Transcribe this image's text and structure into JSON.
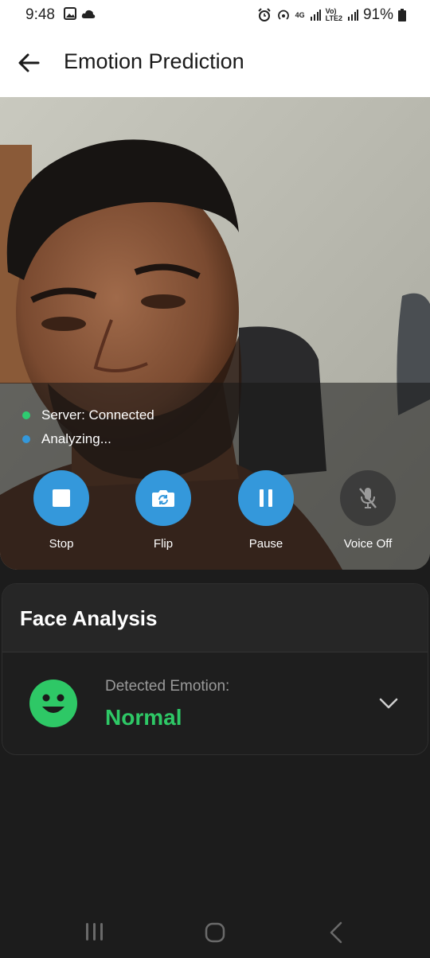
{
  "status_bar": {
    "time": "9:48",
    "network_4g": "4G",
    "volte_top": "Vo)",
    "volte_bottom": "LTE2",
    "battery": "91%"
  },
  "header": {
    "title": "Emotion Prediction",
    "back_icon": "arrow-left-icon"
  },
  "camera": {
    "server_status": "Server: Connected",
    "analysis_status": "Analyzing...",
    "server_dot_color": "#2ecc71",
    "analysis_dot_color": "#3498db",
    "controls": [
      {
        "label": "Stop",
        "icon": "stop-icon",
        "color": "#3498db"
      },
      {
        "label": "Flip",
        "icon": "camera-flip-icon",
        "color": "#3498db"
      },
      {
        "label": "Pause",
        "icon": "pause-icon",
        "color": "#3498db"
      },
      {
        "label": "Voice Off",
        "icon": "mic-off-icon",
        "color": "#2a2a2a"
      }
    ]
  },
  "face_analysis": {
    "title": "Face Analysis",
    "detected_label": "Detected Emotion:",
    "emotion": "Normal",
    "emotion_color": "#2ec866"
  }
}
